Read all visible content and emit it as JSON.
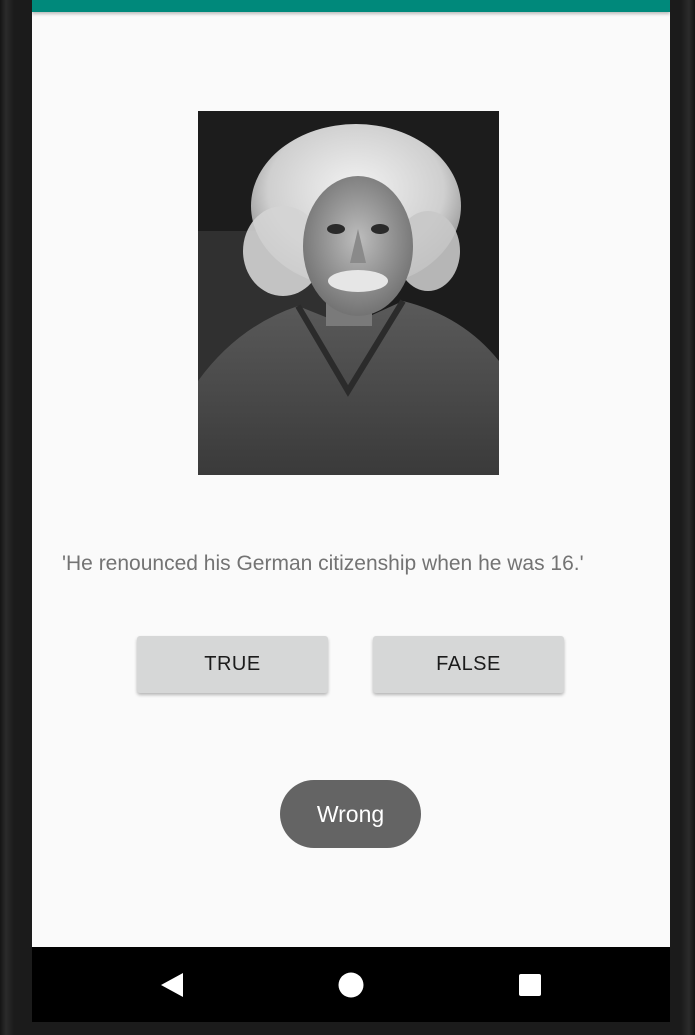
{
  "app": {
    "accent_color": "#00897b",
    "portrait_icon": "portrait-photo"
  },
  "quiz": {
    "question": "'He renounced his German citizenship when he was 16.'",
    "true_label": "TRUE",
    "false_label": "FALSE"
  },
  "toast": {
    "message": "Wrong"
  },
  "navigation": {
    "back_icon": "back-triangle-icon",
    "home_icon": "home-circle-icon",
    "recents_icon": "recents-square-icon"
  }
}
